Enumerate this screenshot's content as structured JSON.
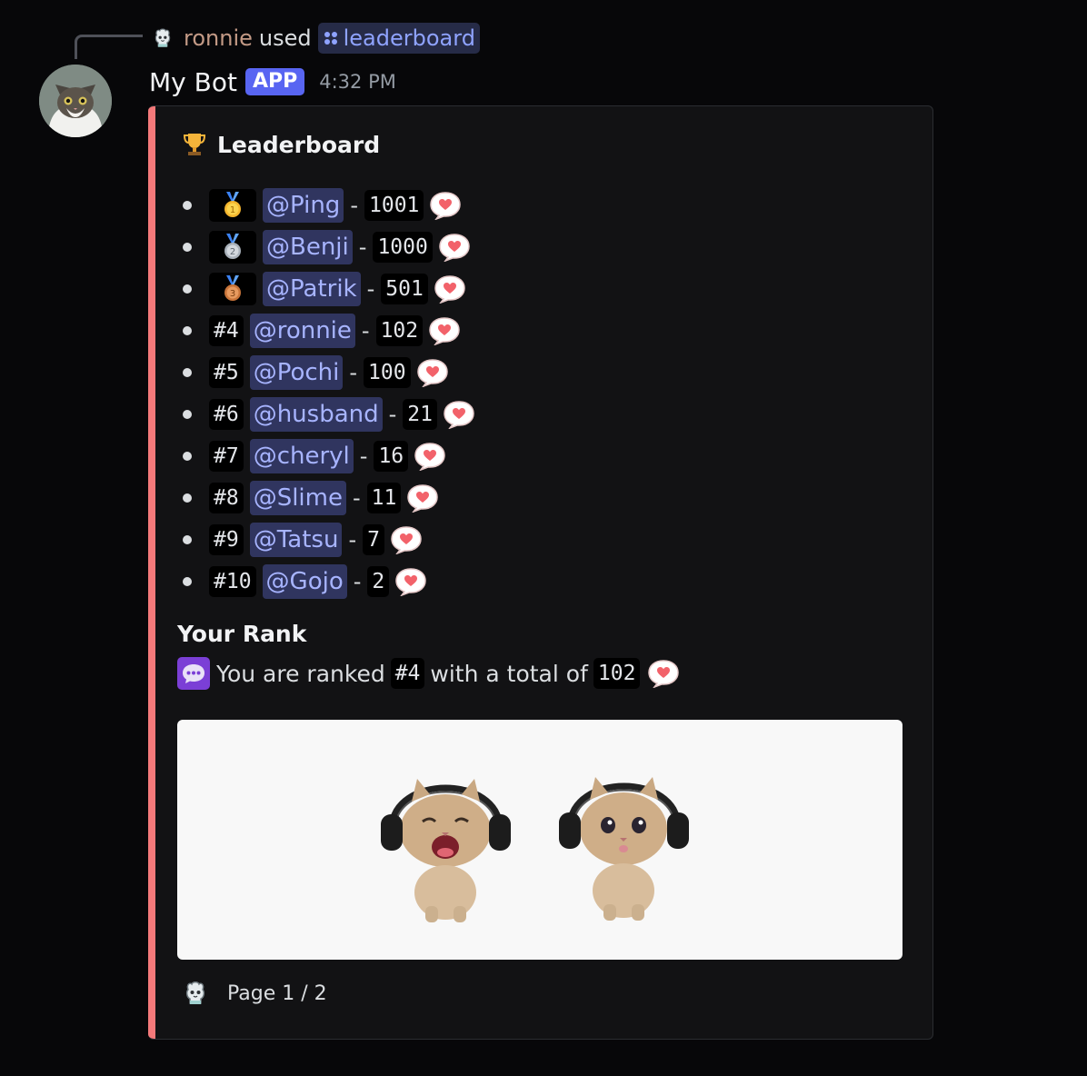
{
  "reply": {
    "username": "ronnie",
    "verb": "used",
    "command": "leaderboard"
  },
  "message": {
    "bot_name": "My Bot",
    "badge": "APP",
    "timestamp": "4:32 PM"
  },
  "embed": {
    "accent_color": "#f4797a",
    "title": "Leaderboard",
    "title_icon": "trophy-icon",
    "entries": [
      {
        "rank": "1",
        "rank_icon": "gold-medal-icon",
        "user": "@Ping",
        "score": "1001"
      },
      {
        "rank": "2",
        "rank_icon": "silver-medal-icon",
        "user": "@Benji",
        "score": "1000"
      },
      {
        "rank": "3",
        "rank_icon": "bronze-medal-icon",
        "user": "@Patrik",
        "score": "501"
      },
      {
        "rank": "#4",
        "user": "@ronnie",
        "score": "102"
      },
      {
        "rank": "#5",
        "user": "@Pochi",
        "score": "100"
      },
      {
        "rank": "#6",
        "user": "@husband",
        "score": "21"
      },
      {
        "rank": "#7",
        "user": "@cheryl",
        "score": "16"
      },
      {
        "rank": "#8",
        "user": "@Slime",
        "score": "11"
      },
      {
        "rank": "#9",
        "user": "@Tatsu",
        "score": "7"
      },
      {
        "rank": "#10",
        "user": "@Gojo",
        "score": "2"
      }
    ],
    "separator": "-",
    "score_icon": "heart-speech-bubble-icon",
    "your_rank": {
      "title": "Your Rank",
      "icon": "speech-bubble-icon",
      "prefix": "You are ranked",
      "rank": "#4",
      "middle": "with a total of",
      "total": "102"
    },
    "image": {
      "description_icon": "cats-with-headphones-image"
    },
    "footer": {
      "icon": "bot-avatar-icon",
      "text": "Page 1 / 2"
    }
  },
  "colors": {
    "background": "#070709",
    "mention_bg": "#30355f",
    "mention_fg": "#a7b4ff",
    "app_badge": "#5865f2"
  }
}
